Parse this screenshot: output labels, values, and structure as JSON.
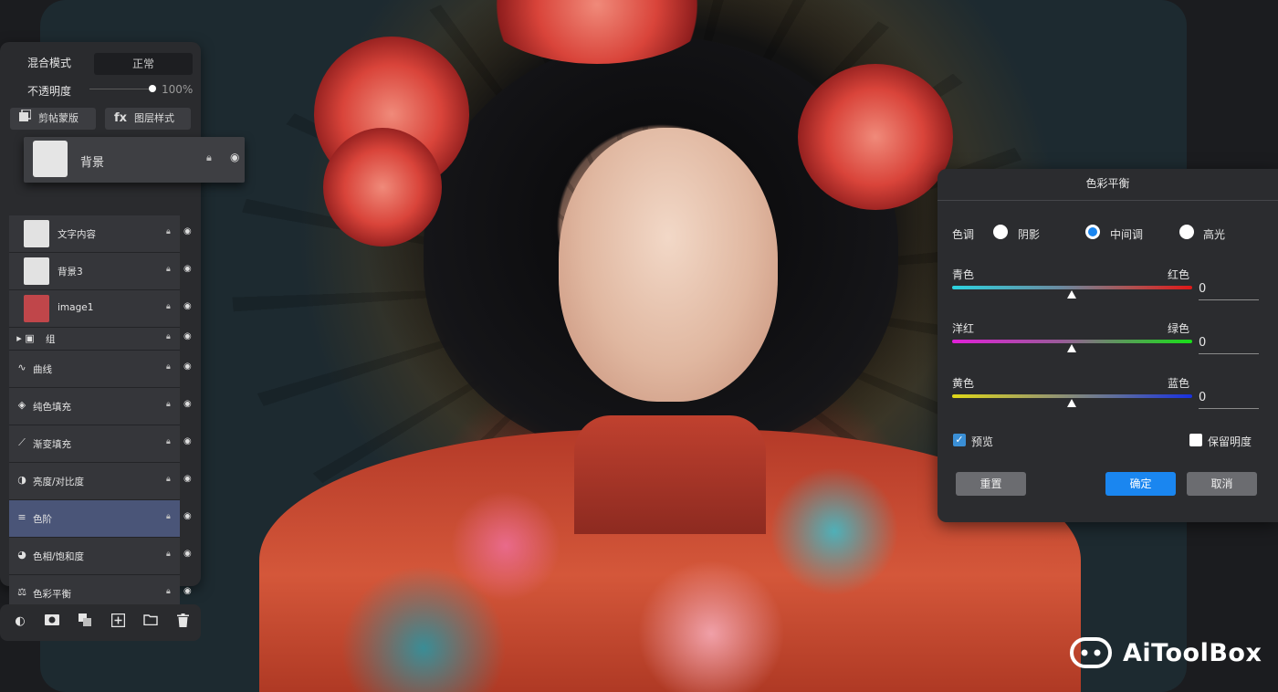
{
  "panel": {
    "blend_label": "混合模式",
    "blend_value": "正常",
    "opacity_label": "不透明度",
    "opacity_value": "100%",
    "clip_mask_label": "剪帖蒙版",
    "layer_style_label": "图层样式"
  },
  "dragged_layer": {
    "name": "背景"
  },
  "layers": [
    {
      "name": "文字内容",
      "thumb": "text"
    },
    {
      "name": "背景3",
      "thumb": "plain"
    },
    {
      "name": "image1",
      "thumb": "red"
    },
    {
      "name": "组",
      "icon": "folder-icon"
    },
    {
      "name": "曲线",
      "icon": "curves-icon"
    },
    {
      "name": "纯色填充",
      "icon": "paint-bucket-icon"
    },
    {
      "name": "渐变填充",
      "icon": "gradient-icon"
    },
    {
      "name": "亮度/对比度",
      "icon": "contrast-icon"
    },
    {
      "name": "色阶",
      "icon": "levels-icon",
      "selected": true
    },
    {
      "name": "色相/饱和度",
      "icon": "palette-icon"
    },
    {
      "name": "色彩平衡",
      "icon": "balance-icon"
    }
  ],
  "bottom_tools": [
    "adjustment-icon",
    "mask-icon",
    "clip-icon",
    "new-layer-icon",
    "new-group-icon",
    "delete-icon"
  ],
  "dialog": {
    "title": "色彩平衡",
    "tone_label": "色调",
    "tones": [
      "阴影",
      "中间调",
      "高光"
    ],
    "selected_tone": "中间调",
    "sliders": [
      {
        "left": "青色",
        "right": "红色",
        "value": "0"
      },
      {
        "left": "洋红",
        "right": "绿色",
        "value": "0"
      },
      {
        "left": "黄色",
        "right": "蓝色",
        "value": "0"
      }
    ],
    "preview_label": "预览",
    "preview_checked": true,
    "preserve_label": "保留明度",
    "preserve_checked": false,
    "reset_label": "重置",
    "ok_label": "确定",
    "cancel_label": "取消",
    "accent": "#1a86f0"
  },
  "watermark": {
    "text": "AiToolBox"
  }
}
